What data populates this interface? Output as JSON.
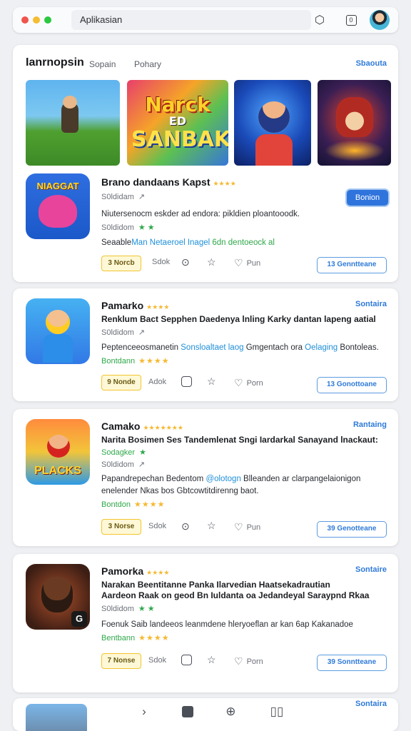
{
  "window": {
    "title": "Aplikasian",
    "toolbar_box_label": "0"
  },
  "header": {
    "title": "Ianrnopsin",
    "tabs": [
      "Sopain",
      "Pohary"
    ],
    "link": "Sbaouta"
  },
  "banners": {
    "b2_line1": "Narck",
    "b2_line2": "ED",
    "b2_line3": "SANBAK"
  },
  "featured": {
    "icon_label": "NIAGGAT",
    "title": "Brano dandaans Kapst",
    "title_stars": "★★★★",
    "meta": "S0ldidam",
    "meta_arrow": "↗",
    "install_label": "Bonion",
    "description": "Niutersenocm eskder ad endora: pikldien ploantooodk.",
    "rating_label": "S0ldidom",
    "rating_marks": "★ ★",
    "desc2_prefix": "Seaable",
    "desc2_highlight": "Man Netaeroel Inagel",
    "desc2_suffix": "6dn dentoeock al",
    "tag": "3 Norcb",
    "actions": {
      "a1": "Sdok",
      "a3": "Pun"
    },
    "outline_btn": "13 Genntteane"
  },
  "apps": [
    {
      "title": "Pamarko",
      "title_stars": "★★★★",
      "side_link": "Sontaira",
      "desc_line1": "Renklum Bact Sepphen Daedenya lnling Karky dantan lapeng aatial",
      "meta": "S0ldidom",
      "meta_arrow": "↗",
      "desc_prefix": "Peptenceeosmanetin",
      "desc_highlight": "Sonsloaltaet laog",
      "desc_mid": "Gmgentach ora",
      "desc_highlight2": "Oelaging",
      "desc_suffix": "Bontoleas.",
      "rating_label": "Bontdann",
      "rating_stars": "★★★★",
      "tag": "9 Nonde",
      "actions": {
        "a1": "Adok",
        "a3": "Porn"
      },
      "outline_btn": "13 Gonottoane"
    },
    {
      "title": "Camako",
      "title_stars": "★★★★★★★",
      "side_link": "Rantaing",
      "icon_label": "PLACKS",
      "desc_line1": "Narita Bosimen Ses Tandemlenat Sngi Iardarkal Sanayand lnackaut:",
      "sub_green": "Sodagker",
      "sub_green_mark": "★",
      "meta": "S0ldidom",
      "meta_arrow": "↗",
      "desc_prefix": "Papandrepechan Bedentom",
      "desc_highlight": "@olotogn",
      "desc_suffix": "Blleanden ar clarpangelaionigon",
      "desc_line3": "enelender Nkas bos Gbtcowtitdirenng baot.",
      "rating_label": "Bontdon",
      "rating_stars": "★★★★",
      "tag": "3 Norse",
      "actions": {
        "a1": "Sdok",
        "a3": "Pun"
      },
      "outline_btn": "39 Genotteane"
    },
    {
      "title": "Pamorka",
      "title_stars": "★★★★",
      "side_link": "Sontaire",
      "icon_badge": "G",
      "desc_line1": "Narakan Beentitanne Panka Ilarvedian Haatsekadrautian",
      "desc_line2": "Aardeon Raak on geod Bn Iuldanta oa Jedandeyal Saraypnd Rkaa",
      "meta": "S0ldidom",
      "meta_mark": "★ ★",
      "desc": "Foenuk Saib landeeos leanmdene hleryoeflan ar kan 6ap Kakanadoe",
      "rating_label": "Bentbann",
      "rating_stars": "★★★★",
      "tag": "7 Nonse",
      "actions": {
        "a1": "Sdok",
        "a3": "Porn"
      },
      "outline_btn": "39 Sonntteane"
    }
  ],
  "peek": {
    "link": "Sontaira"
  },
  "icons": {
    "window": [
      "close-dot",
      "minimize-dot",
      "maximize-dot",
      "extension-icon",
      "box-icon",
      "avatar"
    ],
    "actions": [
      "check-icon",
      "star-icon",
      "heart-icon"
    ],
    "nav": [
      "chevron-right-icon",
      "edit-icon",
      "search-zoom-icon",
      "book-icon"
    ]
  },
  "colors": {
    "accent": "#2f7ad8",
    "star": "#f5b932",
    "green": "#2fa84a",
    "tag_border": "#f1c530"
  }
}
